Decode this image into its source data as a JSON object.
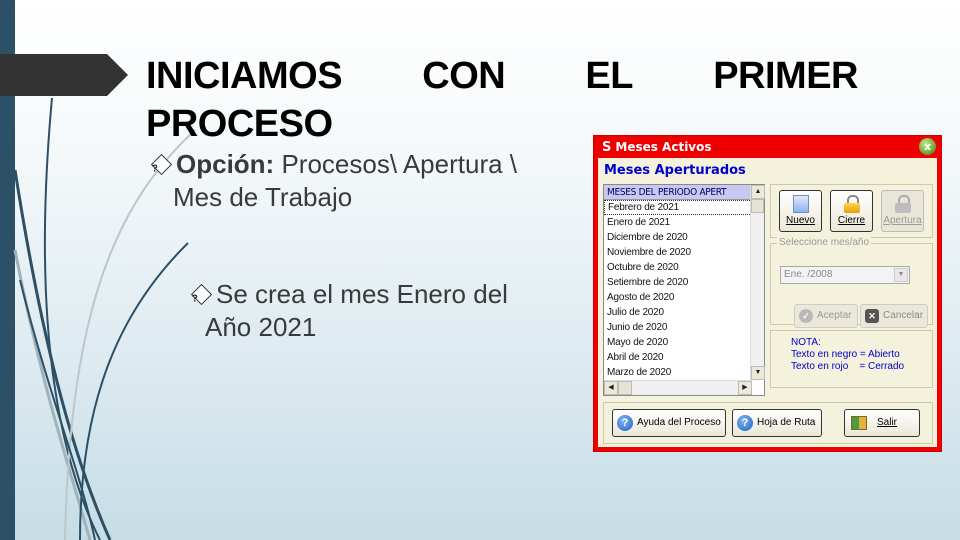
{
  "slide": {
    "title_words": [
      "INICIAMOS",
      "CON",
      "EL",
      "PRIMER"
    ],
    "title_line2": "PROCESO",
    "bullet1": {
      "label": "Opción:",
      "text": " Procesos\\ Apertura \\",
      "continuation": "Mes de Trabajo"
    },
    "bullet2": {
      "text": "Se crea el mes Enero del",
      "continuation": "Año 2021"
    },
    "bullet_icon": "?"
  },
  "window": {
    "logo": "S",
    "title": "Meses Activos",
    "close_glyph": "x",
    "heading": "Meses Aperturados",
    "list": {
      "header": "MESES DEL PERIODO APERT",
      "items": [
        "Febrero de 2021",
        "Enero de 2021",
        "Diciembre de 2020",
        "Noviembre de 2020",
        "Octubre de 2020",
        "Setiembre de 2020",
        "Agosto de 2020",
        "Julio de 2020",
        "Junio de 2020",
        "Mayo de 2020",
        "Abril de 2020",
        "Marzo de 2020"
      ],
      "selected_index": 0
    },
    "toolbar": {
      "new_label": "Nuevo",
      "close_label": "Cierre",
      "open_label": "Apertura"
    },
    "select_group": {
      "label": "Seleccione mes/año",
      "combo_value": "Ene. /2008",
      "accept_label": "Aceptar",
      "cancel_label": "Cancelar"
    },
    "note": {
      "title": "NOTA:",
      "line1": "Texto en negro = Abierto",
      "line2": "Texto en rojo    = Cerrado"
    },
    "bottom": {
      "help_label": "Ayuda del Proceso",
      "route_label": "Hoja de Ruta",
      "exit_label": "Salir"
    }
  },
  "colors": {
    "window_frame": "#ee0000",
    "window_body": "#f4f1dc",
    "heading_blue": "#0000cc",
    "sidebar": "#2d5066"
  }
}
